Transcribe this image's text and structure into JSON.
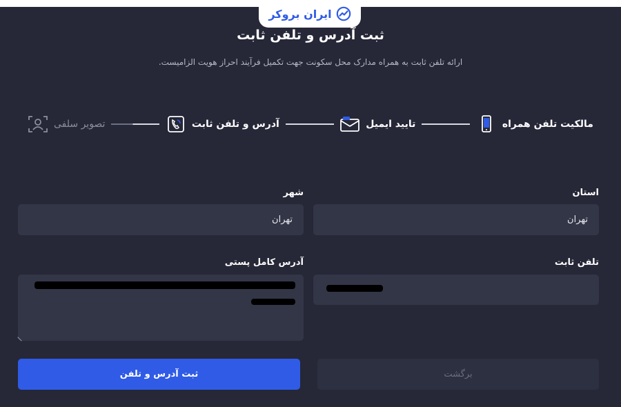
{
  "brand": {
    "name": "ایران بروکر"
  },
  "page": {
    "title": "ثبت آدرس و تلفن ثابت",
    "subtitle": "ارائه تلفن ثابت به همراه مدارک محل سکونت جهت تکمیل فرآیند احراز هویت الزامیست."
  },
  "steps": [
    {
      "label": "مالکیت تلفن همراه",
      "icon": "mobile-phone-icon",
      "state": "done"
    },
    {
      "label": "تایید ایمیل",
      "icon": "email-icon",
      "state": "done"
    },
    {
      "label": "آدرس و تلفن ثابت",
      "icon": "phone-call-icon",
      "state": "active"
    },
    {
      "label": "تصویر سلفی",
      "icon": "selfie-face-icon",
      "state": "inactive"
    }
  ],
  "form": {
    "province": {
      "label": "استان",
      "value": "تهران"
    },
    "city": {
      "label": "شهر",
      "value": "تهران"
    },
    "landline": {
      "label": "تلفن ثابت"
    },
    "address": {
      "label": "آدرس کامل پستی"
    }
  },
  "buttons": {
    "submit": "ثبت آدرس و تلفن",
    "back": "برگشت"
  },
  "colors": {
    "background": "#262838",
    "accent": "#2f5be6",
    "field": "#333647"
  }
}
